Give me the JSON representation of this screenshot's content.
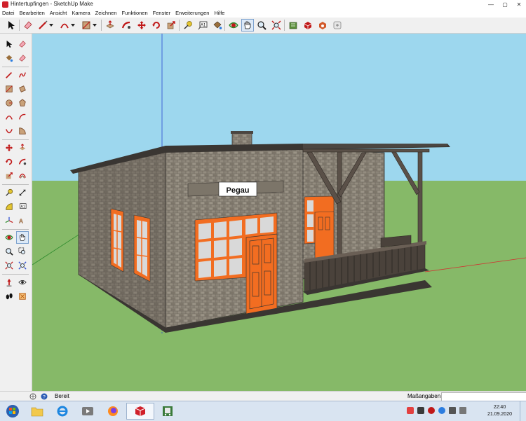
{
  "window": {
    "title": "Hintertupfingen - SketchUp Make",
    "minimize": "—",
    "maximize": "▢",
    "close": "✕"
  },
  "menu": [
    "Datei",
    "Bearbeiten",
    "Ansicht",
    "Kamera",
    "Zeichnen",
    "Funktionen",
    "Fenster",
    "Erweiterungen",
    "Hilfe"
  ],
  "model": {
    "sign_text": "Pegau"
  },
  "status": {
    "text": "Bereit",
    "measurements_label": "Maßangaben",
    "measurements_value": ""
  },
  "taskbar": {
    "time": "22:40",
    "date": "21.09.2020"
  },
  "colors": {
    "sky": "#9dd7ee",
    "ground": "#86b968",
    "wall": "#8a8377",
    "trim": "#f26d21",
    "roof": "#3a3632",
    "porch_wood": "#5a5048"
  }
}
